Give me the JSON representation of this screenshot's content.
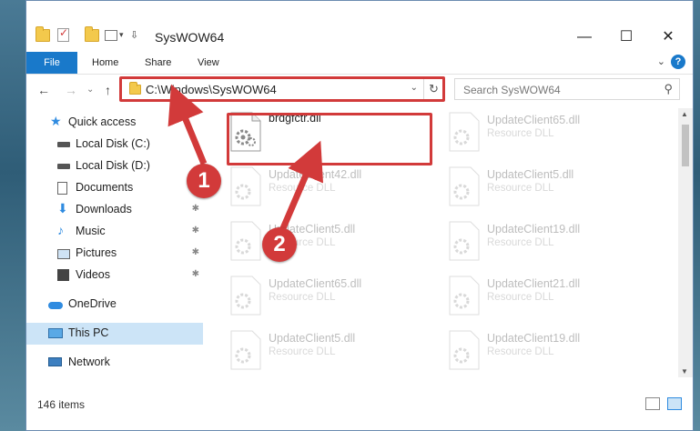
{
  "window": {
    "title": "SysWOW64",
    "minimize_glyph": "—",
    "maximize_glyph": "☐",
    "close_glyph": "✕"
  },
  "ribbon": {
    "file_tab": "File",
    "tabs": [
      "Home",
      "Share",
      "View"
    ],
    "expand_glyph": "⌄",
    "help_glyph": "?"
  },
  "address": {
    "back_glyph": "←",
    "forward_glyph": "→",
    "recent_glyph": "⌄",
    "up_glyph": "↑",
    "path": "C:\\Windows\\SysWOW64",
    "dropdown_glyph": "⌄",
    "refresh_glyph": "↻"
  },
  "search": {
    "placeholder": "Search SysWOW64",
    "icon": "search-icon"
  },
  "sidebar": {
    "items": [
      {
        "label": "Quick access",
        "icon": "star-icon",
        "pinned": false
      },
      {
        "label": "Local Disk (C:)",
        "icon": "drive-icon",
        "pinned": false
      },
      {
        "label": "Local Disk (D:)",
        "icon": "drive-icon",
        "pinned": false
      },
      {
        "label": "Documents",
        "icon": "document-icon",
        "pinned": true
      },
      {
        "label": "Downloads",
        "icon": "download-icon",
        "pinned": true
      },
      {
        "label": "Music",
        "icon": "music-icon",
        "pinned": true
      },
      {
        "label": "Pictures",
        "icon": "pictures-icon",
        "pinned": true
      },
      {
        "label": "Videos",
        "icon": "video-icon",
        "pinned": true
      },
      {
        "label": "OneDrive",
        "icon": "cloud-icon",
        "pinned": false
      },
      {
        "label": "This PC",
        "icon": "computer-icon",
        "pinned": false
      },
      {
        "label": "Network",
        "icon": "network-icon",
        "pinned": false
      }
    ],
    "pin_glyph": "📌"
  },
  "files": [
    {
      "name": "brdgfctr.dll",
      "type": ""
    },
    {
      "name": "UpdateClient65.dll",
      "type": "Resource DLL"
    },
    {
      "name": "UpdateClient42.dll",
      "type": "Resource DLL"
    },
    {
      "name": "UpdateClient5.dll",
      "type": "Resource DLL"
    },
    {
      "name": "UpdateClient5.dll",
      "type": "Resource DLL"
    },
    {
      "name": "UpdateClient19.dll",
      "type": "Resource DLL"
    },
    {
      "name": "UpdateClient65.dll",
      "type": "Resource DLL"
    },
    {
      "name": "UpdateClient21.dll",
      "type": "Resource DLL"
    },
    {
      "name": "UpdateClient5.dll",
      "type": "Resource DLL"
    },
    {
      "name": "UpdateClient19.dll",
      "type": "Resource DLL"
    }
  ],
  "status": {
    "item_count": "146 items"
  },
  "callouts": {
    "step1": "1",
    "step2": "2",
    "color": "#d23a3a"
  }
}
